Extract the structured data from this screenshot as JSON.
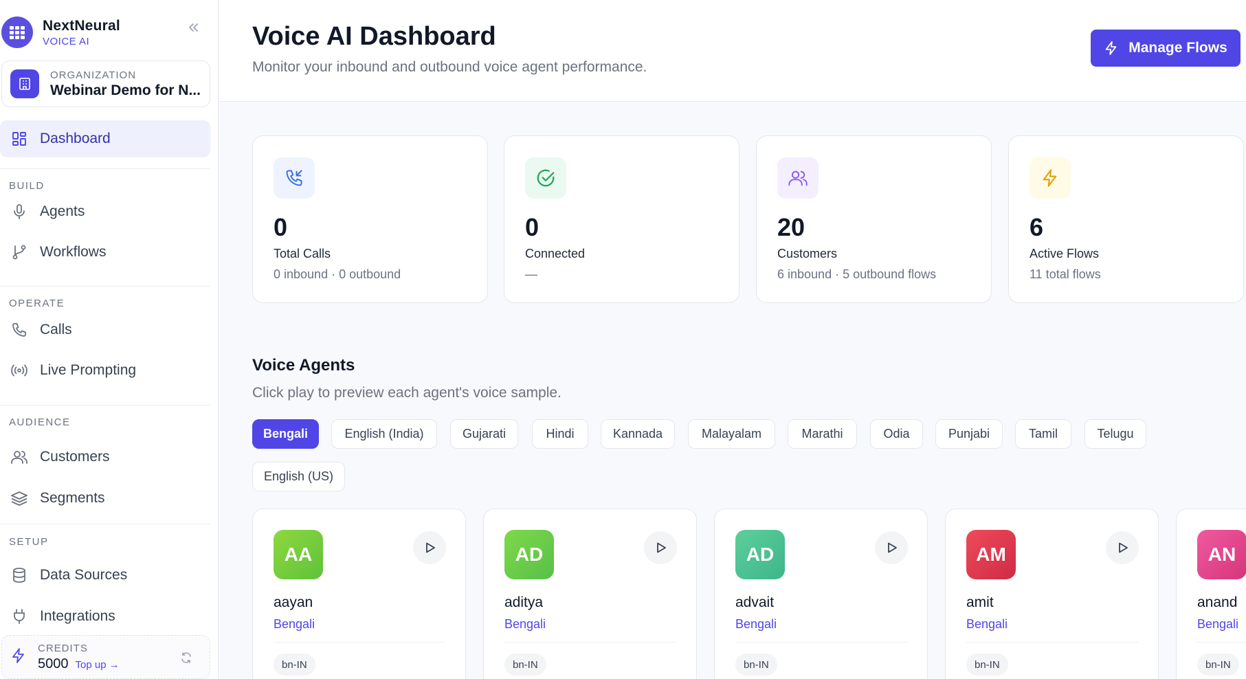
{
  "brand": {
    "name": "NextNeural",
    "sub": "VOICE AI"
  },
  "org": {
    "label": "ORGANIZATION",
    "name": "Webinar Demo for N..."
  },
  "nav": {
    "dashboard": "Dashboard",
    "sections": {
      "build": "BUILD",
      "operate": "OPERATE",
      "audience": "AUDIENCE",
      "setup": "SETUP"
    },
    "agents": "Agents",
    "workflows": "Workflows",
    "calls": "Calls",
    "live_prompting": "Live Prompting",
    "customers": "Customers",
    "segments": "Segments",
    "data_sources": "Data Sources",
    "integrations": "Integrations"
  },
  "credits": {
    "label": "CREDITS",
    "value": "5000",
    "topup": "Top up →"
  },
  "header": {
    "title": "Voice AI Dashboard",
    "subtitle": "Monitor your inbound and outbound voice agent performance.",
    "manage_flows": "Manage Flows"
  },
  "stats": [
    {
      "value": "0",
      "label": "Total Calls",
      "sub": "0 inbound · 0 outbound",
      "icon": "phone-incoming-icon"
    },
    {
      "value": "0",
      "label": "Connected",
      "sub": "—",
      "icon": "check-circle-icon"
    },
    {
      "value": "20",
      "label": "Customers",
      "sub": "6 inbound · 5 outbound flows",
      "icon": "users-icon"
    },
    {
      "value": "6",
      "label": "Active Flows",
      "sub": "11 total flows",
      "icon": "lightning-icon"
    }
  ],
  "voice_agents": {
    "title": "Voice Agents",
    "subtitle": "Click play to preview each agent's voice sample.",
    "languages": [
      "Bengali",
      "English (India)",
      "Gujarati",
      "Hindi",
      "Kannada",
      "Malayalam",
      "Marathi",
      "Odia",
      "Punjabi",
      "Tamil",
      "Telugu",
      "English (US)"
    ],
    "selected_language": "Bengali",
    "agents": [
      {
        "initials": "AA",
        "name": "aayan",
        "language": "Bengali",
        "code": "bn-IN",
        "color": "#7ccf3a"
      },
      {
        "initials": "AD",
        "name": "aditya",
        "language": "Bengali",
        "code": "bn-IN",
        "color": "#6fcf48"
      },
      {
        "initials": "AD",
        "name": "advait",
        "language": "Bengali",
        "code": "bn-IN",
        "color": "#4fbf8c"
      },
      {
        "initials": "AM",
        "name": "amit",
        "language": "Bengali",
        "code": "bn-IN",
        "color": "#e0364f"
      },
      {
        "initials": "AN",
        "name": "anand",
        "language": "Bengali",
        "code": "bn-IN",
        "color": "#e2458f"
      }
    ]
  },
  "colors": {
    "accent": "#4f46e5",
    "accent_soft": "#eef0fd"
  }
}
